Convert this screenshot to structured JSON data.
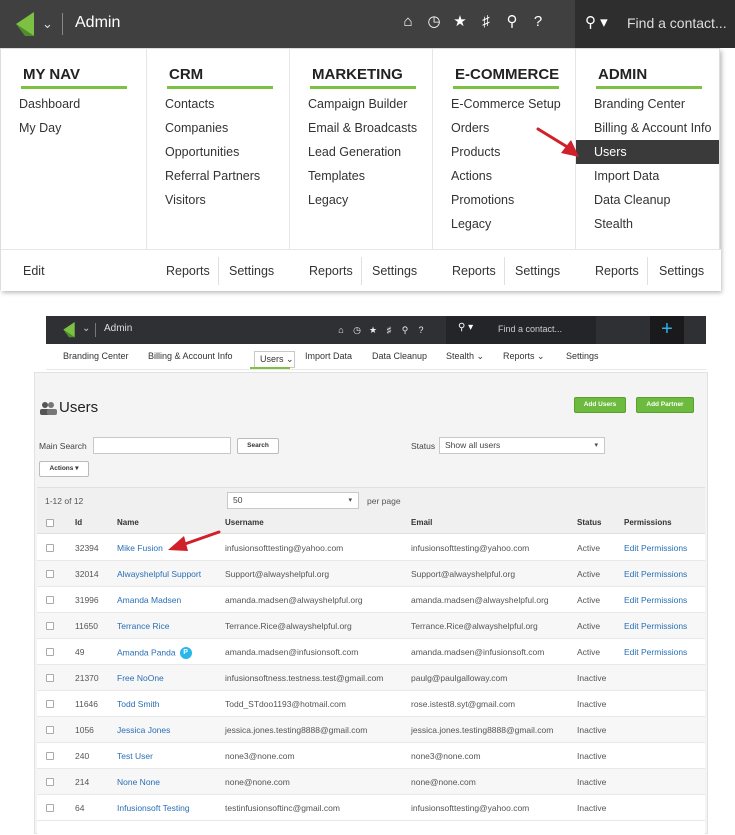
{
  "colors": {
    "accent_green": "#7dc144",
    "dark_bar": "#404040",
    "link_blue": "#2a6fb5",
    "arrow_red": "#d0202a",
    "badge_blue": "#29b6e8"
  },
  "top": {
    "title": "Admin",
    "icons": [
      "home-icon",
      "clock-icon",
      "star-icon",
      "hashtag-icon",
      "person-icon",
      "help-icon"
    ],
    "search": {
      "icon": "search-icon",
      "placeholder": "Find a contact..."
    },
    "columns": [
      {
        "heading": "MY NAV",
        "items": [
          "Dashboard",
          "My Day"
        ]
      },
      {
        "heading": "CRM",
        "items": [
          "Contacts",
          "Companies",
          "Opportunities",
          "Referral Partners",
          "Visitors"
        ]
      },
      {
        "heading": "MARKETING",
        "items": [
          "Campaign Builder",
          "Email & Broadcasts",
          "Lead Generation",
          "Templates",
          "Legacy"
        ]
      },
      {
        "heading": "E-COMMERCE",
        "items": [
          "E-Commerce Setup",
          "Orders",
          "Products",
          "Actions",
          "Promotions",
          "Legacy"
        ]
      },
      {
        "heading": "ADMIN",
        "items": [
          "Branding Center",
          "Billing & Account Info",
          "Users",
          "Import Data",
          "Data Cleanup",
          "Stealth"
        ],
        "active": "Users"
      }
    ],
    "footer": {
      "edit": "Edit",
      "reports": "Reports",
      "settings": "Settings"
    }
  },
  "bottom": {
    "title": "Admin",
    "search_placeholder": "Find a contact...",
    "plus": "+",
    "subnav": [
      "Branding Center",
      "Billing & Account Info",
      "Users ⌄",
      "Import Data",
      "Data Cleanup",
      "Stealth ⌄",
      "Reports ⌄",
      "Settings"
    ],
    "page_title": "Users",
    "add_users": "Add Users",
    "add_partner": "Add Partner",
    "main_search_label": "Main Search",
    "search_button": "Search",
    "status_label": "Status",
    "status_value": "Show all users",
    "actions_button": "Actions ▾",
    "range": "1-12 of 12",
    "per_page_value": "50",
    "per_page_label": "per page",
    "columns": [
      "Id",
      "Name",
      "Username",
      "Email",
      "Status",
      "Permissions"
    ],
    "rows": [
      {
        "id": "32394",
        "name": "Mike Fusion",
        "username": "infusionsofttesting@yahoo.com",
        "email": "infusionsofttesting@yahoo.com",
        "status": "Active",
        "perm": "Edit Permissions",
        "badge": ""
      },
      {
        "id": "32014",
        "name": "Alwayshelpful Support",
        "username": "Support@alwayshelpful.org",
        "email": "Support@alwayshelpful.org",
        "status": "Active",
        "perm": "Edit Permissions",
        "badge": ""
      },
      {
        "id": "31996",
        "name": "Amanda Madsen",
        "username": "amanda.madsen@alwayshelpful.org",
        "email": "amanda.madsen@alwayshelpful.org",
        "status": "Active",
        "perm": "Edit Permissions",
        "badge": ""
      },
      {
        "id": "11650",
        "name": "Terrance Rice",
        "username": "Terrance.Rice@alwayshelpful.org",
        "email": "Terrance.Rice@alwayshelpful.org",
        "status": "Active",
        "perm": "Edit Permissions",
        "badge": ""
      },
      {
        "id": "49",
        "name": "Amanda Panda",
        "username": "amanda.madsen@infusionsoft.com",
        "email": "amanda.madsen@infusionsoft.com",
        "status": "Active",
        "perm": "Edit Permissions",
        "badge": "P"
      },
      {
        "id": "21370",
        "name": "Free NoOne",
        "username": "infusionsoftness.testness.test@gmail.com",
        "email": "paulg@paulgalloway.com",
        "status": "Inactive",
        "perm": "",
        "badge": ""
      },
      {
        "id": "11646",
        "name": "Todd Smith",
        "username": "Todd_STdoo1193@hotmail.com",
        "email": "rose.istest8.syt@gmail.com",
        "status": "Inactive",
        "perm": "",
        "badge": ""
      },
      {
        "id": "1056",
        "name": "Jessica Jones",
        "username": "jessica.jones.testing8888@gmail.com",
        "email": "jessica.jones.testing8888@gmail.com",
        "status": "Inactive",
        "perm": "",
        "badge": ""
      },
      {
        "id": "240",
        "name": "Test User",
        "username": "none3@none.com",
        "email": "none3@none.com",
        "status": "Inactive",
        "perm": "",
        "badge": ""
      },
      {
        "id": "214",
        "name": "None None",
        "username": "none@none.com",
        "email": "none@none.com",
        "status": "Inactive",
        "perm": "",
        "badge": ""
      },
      {
        "id": "64",
        "name": "Infusionsoft Testing",
        "username": "testinfusionsoftinc@gmail.com",
        "email": "infusionsofttesting@yahoo.com",
        "status": "Inactive",
        "perm": "",
        "badge": ""
      }
    ]
  }
}
